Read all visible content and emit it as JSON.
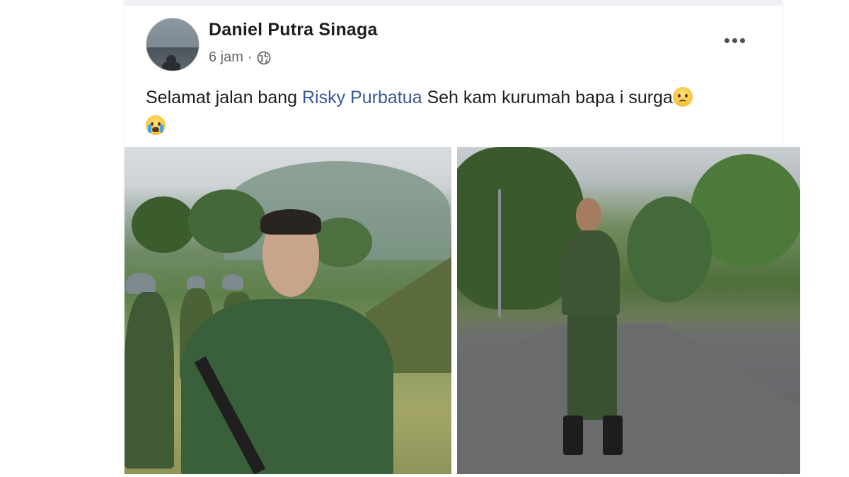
{
  "post": {
    "author": "Daniel Putra Sinaga",
    "time": "6 jam",
    "separator": "·",
    "privacy_icon": "globe-icon",
    "text_before": "Selamat jalan bang ",
    "mention": "Risky Purbatua",
    "text_after": " Seh kam kurumah bapa i surga",
    "emojis": [
      "sad-face-emoji",
      "crying-face-emoji"
    ]
  },
  "photos": [
    {
      "name": "soldier-portrait-photo"
    },
    {
      "name": "soldier-standing-photo"
    }
  ],
  "colors": {
    "author": "#1c1e21",
    "meta": "#65676b",
    "mention": "#385898"
  }
}
